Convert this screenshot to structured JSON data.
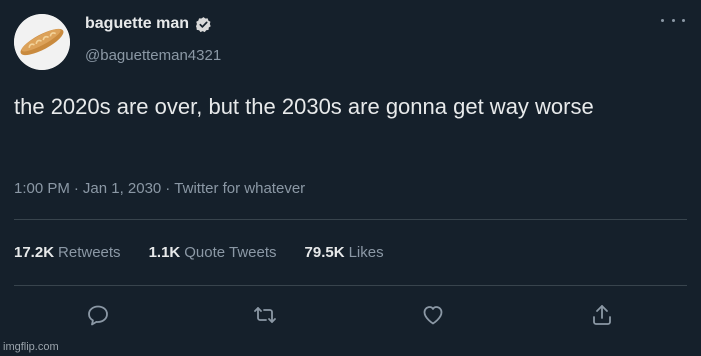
{
  "author": {
    "display_name": "baguette man",
    "handle": "@baguetteman4321",
    "avatar_icon": "baguette-avatar",
    "verified_icon": "verified-badge-icon"
  },
  "tweet": {
    "text": "the 2020s are over, but the 2030s are gonna get way worse",
    "time": "1:00 PM",
    "date": "Jan 1, 2030",
    "source": "Twitter for whatever",
    "separator": "·"
  },
  "stats": {
    "retweets_value": "17.2K",
    "retweets_label": "Retweets",
    "quotes_value": "1.1K",
    "quotes_label": "Quote Tweets",
    "likes_value": "79.5K",
    "likes_label": "Likes"
  },
  "actions": [
    "reply-icon",
    "retweet-icon",
    "like-icon",
    "share-icon"
  ],
  "watermark": "imgflip.com",
  "colors": {
    "background": "#15202b",
    "primary_text": "#e7e9ea",
    "secondary_text": "#8b98a5",
    "divider": "#38444d",
    "verified": "#d9d9d9"
  }
}
